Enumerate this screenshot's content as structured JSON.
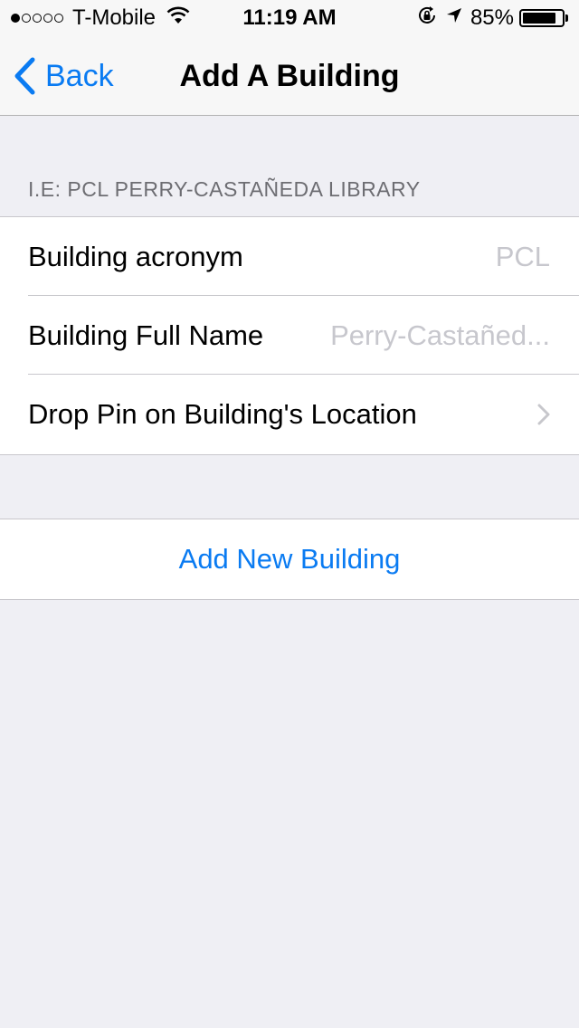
{
  "status_bar": {
    "carrier": "T-Mobile",
    "time": "11:19 AM",
    "battery_text": "85%",
    "battery_level": 0.85,
    "signal_bars_filled": 1,
    "signal_bars_total": 5
  },
  "nav": {
    "back_label": "Back",
    "title": "Add A Building"
  },
  "form": {
    "section_header": "I.E: PCL PERRY-CASTAÑEDA LIBRARY",
    "acronym_label": "Building acronym",
    "acronym_placeholder": "PCL",
    "acronym_value": "",
    "full_name_label": "Building Full Name",
    "full_name_placeholder": "Perry-Castañed...",
    "full_name_value": "",
    "drop_pin_label": "Drop Pin on Building's Location"
  },
  "actions": {
    "add_new_building_label": "Add New Building"
  },
  "colors": {
    "accent": "#0a7bf2",
    "background": "#efeff4",
    "placeholder": "#c7c7cd",
    "section_header": "#6d6d72"
  },
  "icons": [
    "signal-icon",
    "wifi-icon",
    "rotation-lock-icon",
    "location-arrow-icon",
    "battery-icon",
    "back-chevron-icon",
    "disclosure-chevron-icon"
  ]
}
